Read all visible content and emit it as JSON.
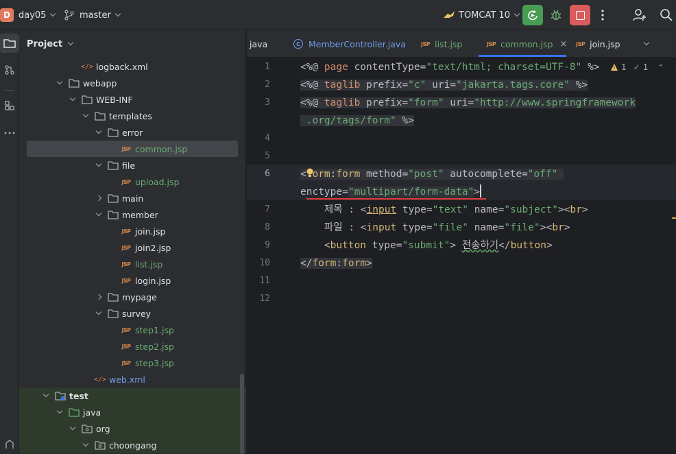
{
  "toolbar": {
    "project_badge": "D",
    "project_name": "day05",
    "branch": "master",
    "run_config": "TOMCAT 10"
  },
  "project_panel": {
    "title": "Project",
    "tree": [
      {
        "label": "logback.xml",
        "kind": "xml",
        "depth": 4,
        "color": "default"
      },
      {
        "label": "webapp",
        "kind": "folder",
        "depth": 3,
        "expanded": true
      },
      {
        "label": "WEB-INF",
        "kind": "folder",
        "depth": 4,
        "expanded": true
      },
      {
        "label": "templates",
        "kind": "folder",
        "depth": 5,
        "expanded": true
      },
      {
        "label": "error",
        "kind": "folder",
        "depth": 6,
        "expanded": true
      },
      {
        "label": "common.jsp",
        "kind": "jsp",
        "depth": 7,
        "color": "green",
        "selected": true
      },
      {
        "label": "file",
        "kind": "folder",
        "depth": 6,
        "expanded": true
      },
      {
        "label": "upload.jsp",
        "kind": "jsp",
        "depth": 7,
        "color": "green"
      },
      {
        "label": "main",
        "kind": "folder",
        "depth": 6,
        "expanded": false
      },
      {
        "label": "member",
        "kind": "folder",
        "depth": 6,
        "expanded": true
      },
      {
        "label": "join.jsp",
        "kind": "jsp",
        "depth": 7,
        "color": "default"
      },
      {
        "label": "join2.jsp",
        "kind": "jsp",
        "depth": 7,
        "color": "default"
      },
      {
        "label": "list.jsp",
        "kind": "jsp",
        "depth": 7,
        "color": "green"
      },
      {
        "label": "login.jsp",
        "kind": "jsp",
        "depth": 7,
        "color": "default"
      },
      {
        "label": "mypage",
        "kind": "folder",
        "depth": 6,
        "expanded": false
      },
      {
        "label": "survey",
        "kind": "folder",
        "depth": 6,
        "expanded": true
      },
      {
        "label": "step1.jsp",
        "kind": "jsp",
        "depth": 7,
        "color": "green"
      },
      {
        "label": "step2.jsp",
        "kind": "jsp",
        "depth": 7,
        "color": "green"
      },
      {
        "label": "step3.jsp",
        "kind": "jsp",
        "depth": 7,
        "color": "green"
      },
      {
        "label": "web.xml",
        "kind": "xml",
        "depth": 5,
        "color": "blue"
      },
      {
        "label": "test",
        "kind": "test-folder",
        "depth": 2,
        "expanded": true,
        "bold": true
      },
      {
        "label": "java",
        "kind": "src-folder",
        "depth": 3,
        "expanded": true
      },
      {
        "label": "org",
        "kind": "package",
        "depth": 4,
        "expanded": true
      },
      {
        "label": "choongang",
        "kind": "package",
        "depth": 5,
        "expanded": true
      }
    ]
  },
  "tabs": [
    {
      "label": "java",
      "icon": "none"
    },
    {
      "label": "MemberController.java",
      "icon": "class-icon",
      "color": "blue"
    },
    {
      "label": "list.jsp",
      "icon": "jsp",
      "color": "green"
    },
    {
      "label": "common.jsp",
      "icon": "jsp",
      "color": "green",
      "active": true
    },
    {
      "label": "join.jsp",
      "icon": "jsp",
      "color": "default"
    }
  ],
  "editor": {
    "warnings": "1",
    "checks": "1",
    "line_numbers": [
      "1",
      "2",
      "3",
      "",
      "4",
      "5",
      "6",
      "",
      "7",
      "8",
      "9",
      "10",
      "11",
      "12"
    ]
  },
  "colors": {
    "accent": "#3574f0",
    "jsp": "#d98a4e",
    "green_file": "#6aab73",
    "run_green": "#499c54",
    "stop_red": "#db5c5c"
  }
}
